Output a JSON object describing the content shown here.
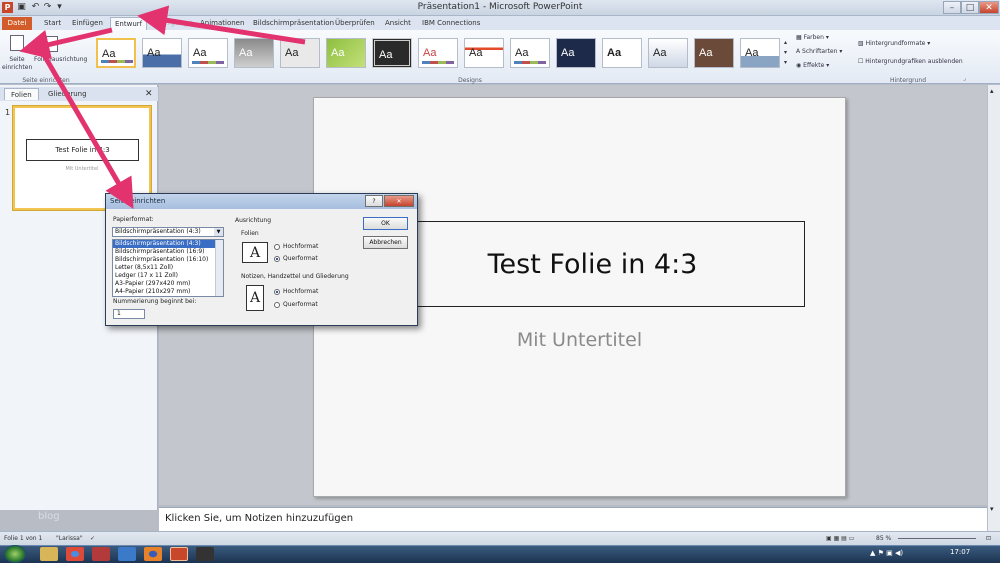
{
  "window": {
    "title": "Präsentation1  -  Microsoft PowerPoint",
    "buttons": {
      "min": "–",
      "max": "□",
      "close": "✕"
    }
  },
  "qat_icons": [
    "powerpoint-logo-icon",
    "save-icon",
    "undo-icon",
    "redo-icon",
    "customize-icon"
  ],
  "tabs": [
    "Datei",
    "Start",
    "Einfügen",
    "Entwurf",
    "Übergänge",
    "Animationen",
    "Bildschirmpräsentation",
    "Überprüfen",
    "Ansicht",
    "IBM Connections"
  ],
  "tab_ghost": "Übergänge",
  "ribbon": {
    "seite_einrichten": "Seite einrichten",
    "folienausrichtung": "Folienausrichtung",
    "group_seite": "Seite einrichten",
    "group_designs": "Designs",
    "group_hintergrund": "Hintergrund",
    "farben": "Farben",
    "schriftarten": "Schriftarten",
    "effekte": "Effekte",
    "hintergrundformate": "Hintergrundformate",
    "hintergrundgrafiken": "Hintergrundgrafiken ausblenden",
    "theme_label": "Aa"
  },
  "pane": {
    "tab_folien": "Folien",
    "tab_gliederung": "Gliederung",
    "close": "✕",
    "slide_number": "1",
    "thumb_title": "Test Folie in 4:3",
    "thumb_sub": "Mit Untertitel"
  },
  "slide": {
    "title": "Test Folie in 4:3",
    "subtitle": "Mit Untertitel"
  },
  "notes": "Klicken Sie, um Notizen hinzuzufügen",
  "watermark": "blog",
  "status": {
    "folie": "Folie 1 von 1",
    "design": "\"Larissa\"",
    "zoom": "85 %",
    "time": "17:07"
  },
  "dialog": {
    "title": "Seite einrichten",
    "help": "?",
    "close": "✕",
    "papierformat_label": "Papierformat:",
    "papierformat_value": "Bildschirmpräsentation (4:3)",
    "options": [
      "Bildschirmpräsentation (4:3)",
      "Bildschirmpräsentation (16:9)",
      "Bildschirmpräsentation (16:10)",
      "Letter (8,5x11 Zoll)",
      "Ledger (17 x 11 Zoll)",
      "A3-Papier (297x420 mm)",
      "A4-Papier (210x297 mm)"
    ],
    "nummerierung_label": "Nummerierung beginnt bei:",
    "nummerierung_value": "1",
    "ausrichtung": "Ausrichtung",
    "folien": "Folien",
    "hochformat": "Hochformat",
    "querformat": "Querformat",
    "notizen": "Notizen, Handzettel und Gliederung",
    "ok": "OK",
    "abbrechen": "Abbrechen"
  },
  "colors": {
    "accent": "#e2336f",
    "file_tab": "#d35d2a",
    "selection": "#3a6ec4"
  }
}
